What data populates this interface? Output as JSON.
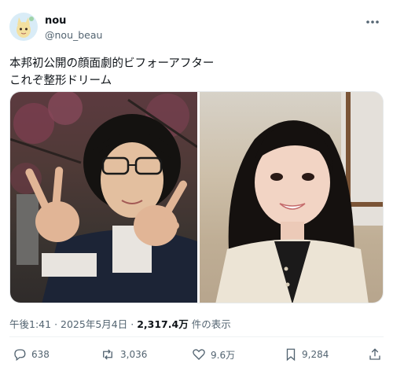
{
  "author": {
    "name": "nou",
    "handle": "@nou_beau"
  },
  "tweet": {
    "text_line1": "本邦初公開の顔面劇的ビフォーアフター",
    "text_line2": "これぞ整形ドリーム"
  },
  "meta": {
    "time": "午後1:41",
    "separator": "·",
    "date": "2025年5月4日",
    "views": "2,317.4万",
    "views_suffix": "件の表示"
  },
  "actions": {
    "replies": "638",
    "retweets": "3,036",
    "likes": "9.6万",
    "bookmarks": "9,284"
  },
  "icons": [
    "avatar",
    "more-icon",
    "reply-icon",
    "retweet-icon",
    "like-icon",
    "bookmark-icon",
    "share-icon"
  ],
  "colors": {
    "text": "#0f1419",
    "secondary": "#536471",
    "divider": "#eff3f4"
  }
}
